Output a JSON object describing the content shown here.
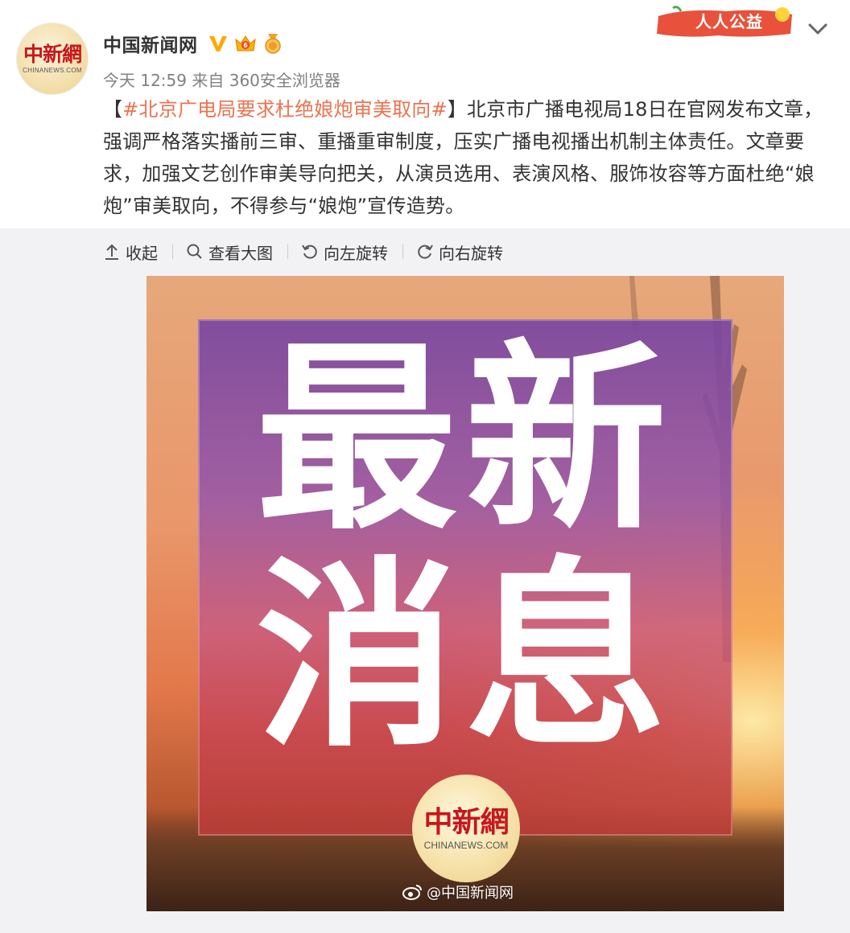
{
  "account": {
    "avatar_logo_cn": "中新網",
    "avatar_logo_en": "CHINANEWS.COM",
    "name": "中国新闻网"
  },
  "meta": {
    "time": "今天 12:59",
    "source": "来自 360安全浏览器"
  },
  "promo": {
    "label": "人人公益"
  },
  "post": {
    "open_bracket": "【",
    "hashtag": "#北京广电局要求杜绝娘炮审美取向#",
    "close_bracket": "】",
    "body": "北京市广播电视局18日在官网发布文章，强调严格落实播前三审、重播重审制度，压实广播电视播出机制主体责任。文章要求，加强文艺创作审美导向把关，从演员选用、表演风格、服饰妆容等方面杜绝“娘炮”审美取向，不得参与“娘炮”宣传造势。"
  },
  "toolbar": {
    "collapse": "收起",
    "view_large": "查看大图",
    "rotate_left": "向左旋转",
    "rotate_right": "向右旋转"
  },
  "image": {
    "line1": "最新",
    "line2": "消息",
    "logo_cn": "中新網",
    "logo_en": "CHINANEWS.COM",
    "watermark": "@中国新闻网"
  },
  "colors": {
    "hashtag": "#eb7350",
    "verified": "#ffa800",
    "gray_bg": "#f2f2f5"
  }
}
